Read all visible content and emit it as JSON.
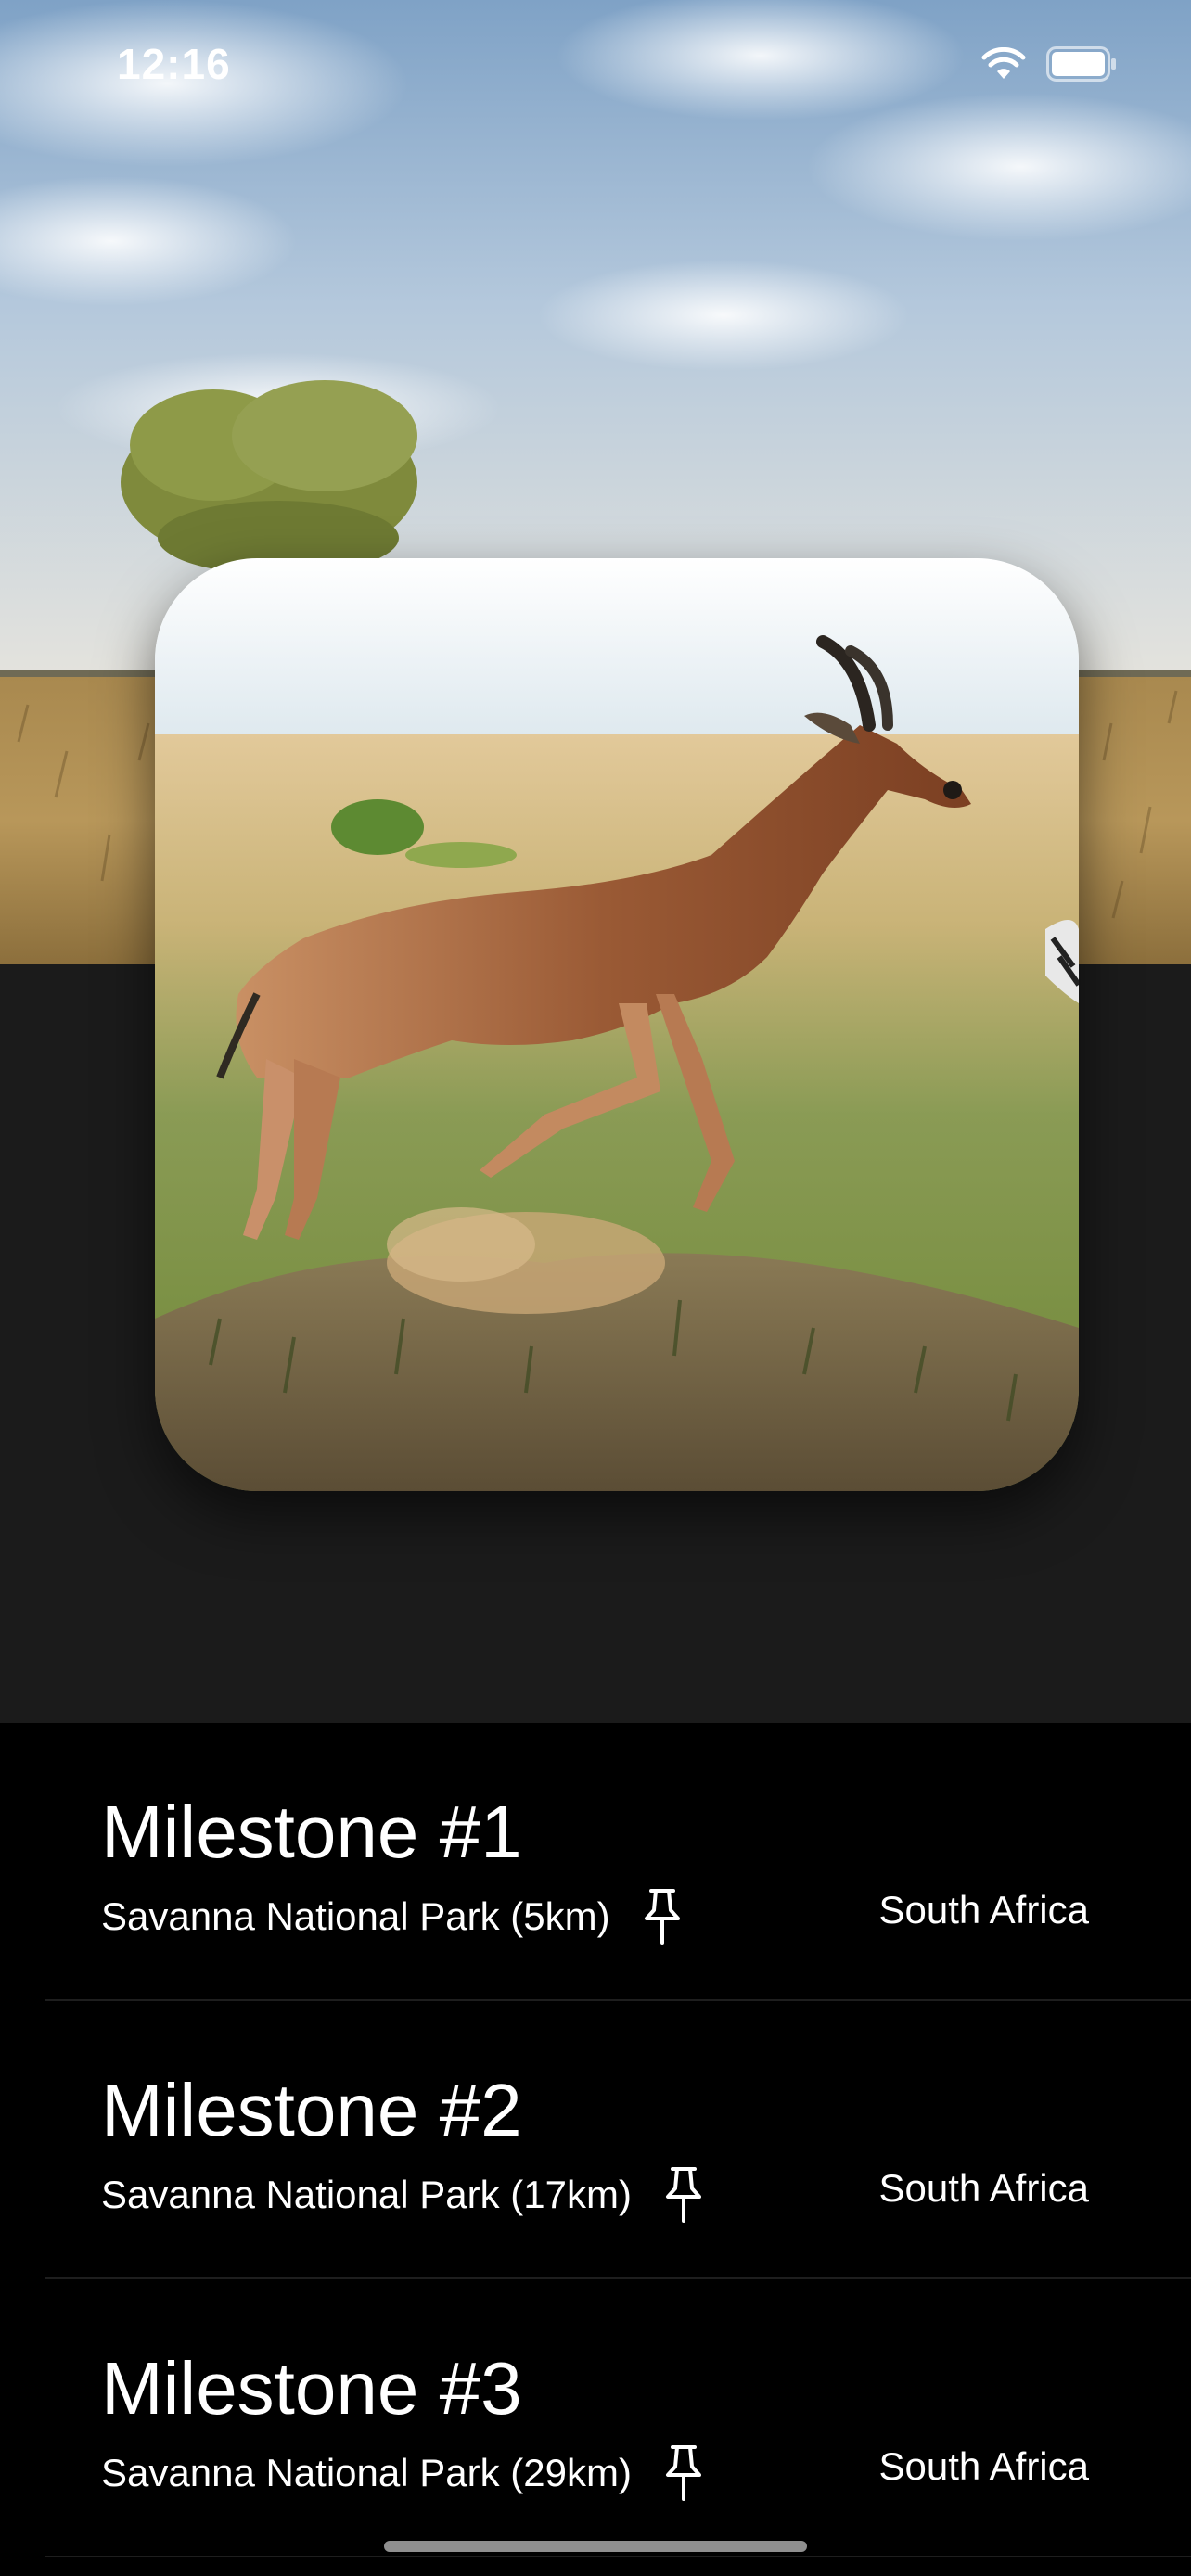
{
  "status_bar": {
    "time": "12:16"
  },
  "colors": {
    "background": "#000000",
    "panel": "#1b1b1b",
    "text": "#ffffff"
  },
  "hero": {
    "icon": "antelope-photo"
  },
  "milestones": [
    {
      "title": "Milestone #1",
      "park": "Savanna National Park (5km)",
      "country": "South Africa",
      "icon": "pin-icon"
    },
    {
      "title": "Milestone #2",
      "park": "Savanna National Park (17km)",
      "country": "South Africa",
      "icon": "pin-icon"
    },
    {
      "title": "Milestone #3",
      "park": "Savanna National Park (29km)",
      "country": "South Africa",
      "icon": "pin-icon"
    }
  ]
}
